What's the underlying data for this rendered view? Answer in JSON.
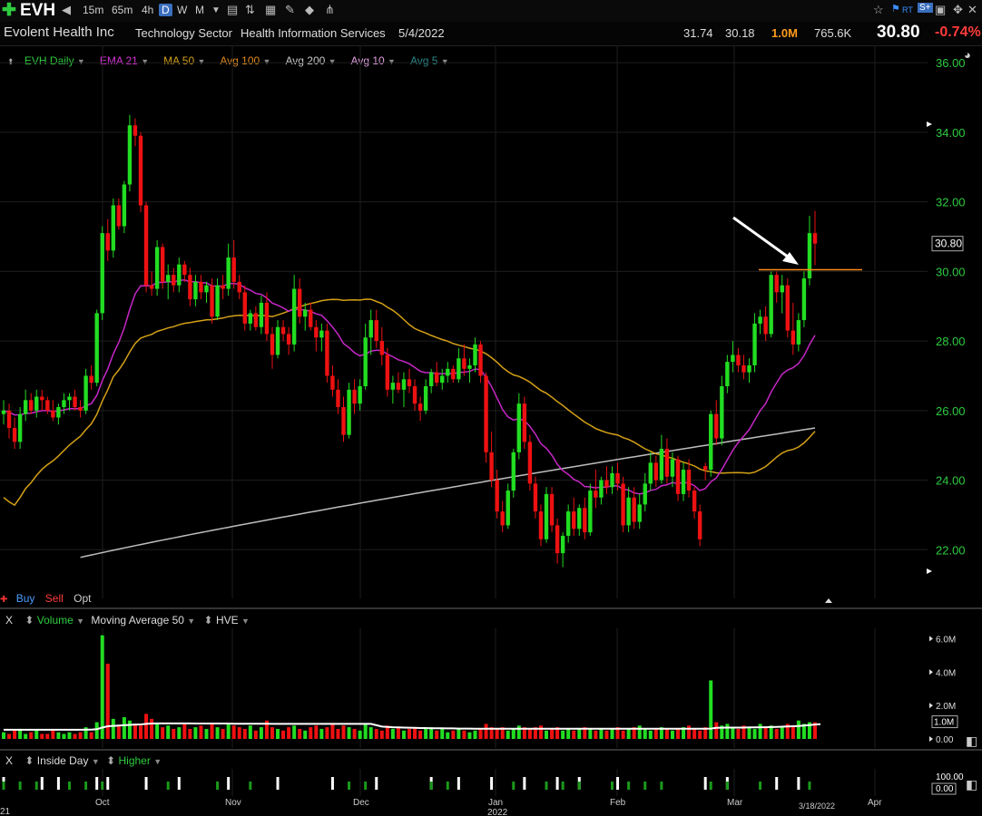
{
  "toolbar": {
    "symbol": "EVH",
    "timeframes": [
      "15m",
      "65m",
      "4h",
      "D",
      "W",
      "M"
    ],
    "active_timeframe": "D"
  },
  "info": {
    "company": "Evolent Health Inc",
    "sector": "Technology Sector",
    "industry": "Health Information Services",
    "date": "5/4/2022",
    "high": "31.74",
    "low": "30.18",
    "volume": "1.0M",
    "avg_volume": "765.6K",
    "price": "30.80",
    "change": "-0.74%"
  },
  "legend": {
    "items": [
      {
        "label": "EVH Daily",
        "color": "#2ecc40"
      },
      {
        "label": "EMA 21",
        "color": "#d633d6"
      },
      {
        "label": "MA 50",
        "color": "#d4a017"
      },
      {
        "label": "Avg 100",
        "color": "#e08a1e"
      },
      {
        "label": "Avg 200",
        "color": "#cccccc"
      },
      {
        "label": "Avg 10",
        "color": "#e0a0e0"
      },
      {
        "label": "Avg 5",
        "color": "#2a8a8a"
      }
    ]
  },
  "buysell": {
    "buy": "Buy",
    "sell": "Sell",
    "opt": "Opt"
  },
  "volume_panel": {
    "close": "X",
    "title": "Volume",
    "ma": "Moving Average 50",
    "hve": "HVE"
  },
  "inside_panel": {
    "close": "X",
    "title": "Inside Day",
    "second": "Higher"
  },
  "colors": {
    "up": "#22dd22",
    "down": "#ee1111",
    "bg": "#000000"
  },
  "chart_data": {
    "type": "candlestick",
    "price_axis": {
      "ticks": [
        "36.00",
        "34.00",
        "32.00",
        "30.00",
        "28.00",
        "26.00",
        "24.00",
        "22.00"
      ],
      "range": [
        20.6,
        36.5
      ]
    },
    "last_price_label": "30.80",
    "resistance_level": 30.05,
    "x_labels": [
      "Oct",
      "Nov",
      "Dec",
      "Jan",
      "Feb",
      "Mar",
      "Apr"
    ],
    "x_year_label": "2022",
    "x_left_partial": "21",
    "x_date_marker": "3/18/2022",
    "candles": [
      [
        25.9,
        26.3,
        25.6,
        26.0
      ],
      [
        26.0,
        26.2,
        25.2,
        25.5
      ],
      [
        25.5,
        25.8,
        24.9,
        25.1
      ],
      [
        25.1,
        26.1,
        24.9,
        25.9
      ],
      [
        25.9,
        26.6,
        25.7,
        26.3
      ],
      [
        26.3,
        26.5,
        25.9,
        26.0
      ],
      [
        26.0,
        26.6,
        25.8,
        26.4
      ],
      [
        26.4,
        26.6,
        26.0,
        26.3
      ],
      [
        26.3,
        26.4,
        25.9,
        26.0
      ],
      [
        26.0,
        26.3,
        25.7,
        25.8
      ],
      [
        25.8,
        26.2,
        25.6,
        26.1
      ],
      [
        26.1,
        26.5,
        25.9,
        26.3
      ],
      [
        26.3,
        26.5,
        26.0,
        26.4
      ],
      [
        26.4,
        26.6,
        26.0,
        26.1
      ],
      [
        26.1,
        26.3,
        25.8,
        26.0
      ],
      [
        26.0,
        27.2,
        25.9,
        27.0
      ],
      [
        27.0,
        27.3,
        26.6,
        26.8
      ],
      [
        26.8,
        28.9,
        26.7,
        28.8
      ],
      [
        28.8,
        31.3,
        28.6,
        31.1
      ],
      [
        31.1,
        31.5,
        30.3,
        30.6
      ],
      [
        30.6,
        32.1,
        30.4,
        31.9
      ],
      [
        31.9,
        32.1,
        31.2,
        31.3
      ],
      [
        31.3,
        32.6,
        31.1,
        32.5
      ],
      [
        32.5,
        34.5,
        32.3,
        34.2
      ],
      [
        34.2,
        34.4,
        33.6,
        33.9
      ],
      [
        33.9,
        34.0,
        31.7,
        31.9
      ],
      [
        31.9,
        32.0,
        29.4,
        29.6
      ],
      [
        29.6,
        30.0,
        29.3,
        29.5
      ],
      [
        29.5,
        30.9,
        29.3,
        30.7
      ],
      [
        30.7,
        30.8,
        29.5,
        29.7
      ],
      [
        29.7,
        30.2,
        29.2,
        29.9
      ],
      [
        29.9,
        30.1,
        29.4,
        29.6
      ],
      [
        29.6,
        30.4,
        29.4,
        30.2
      ],
      [
        30.2,
        30.3,
        29.7,
        29.9
      ],
      [
        29.9,
        30.1,
        29.0,
        29.2
      ],
      [
        29.2,
        29.9,
        29.0,
        29.7
      ],
      [
        29.7,
        29.9,
        29.2,
        29.4
      ],
      [
        29.4,
        29.7,
        29.1,
        29.6
      ],
      [
        29.6,
        29.8,
        28.5,
        28.7
      ],
      [
        28.7,
        29.8,
        28.6,
        29.6
      ],
      [
        29.6,
        29.9,
        29.2,
        29.5
      ],
      [
        29.5,
        30.8,
        29.3,
        30.4
      ],
      [
        30.4,
        30.9,
        29.5,
        29.7
      ],
      [
        29.7,
        29.9,
        29.2,
        29.4
      ],
      [
        29.4,
        29.6,
        28.3,
        28.5
      ],
      [
        28.5,
        28.9,
        28.3,
        28.8
      ],
      [
        28.8,
        29.0,
        28.3,
        28.4
      ],
      [
        28.4,
        29.3,
        28.2,
        29.1
      ],
      [
        29.1,
        29.4,
        28.0,
        28.2
      ],
      [
        28.2,
        28.4,
        27.2,
        27.6
      ],
      [
        27.6,
        28.6,
        27.5,
        28.4
      ],
      [
        28.4,
        28.6,
        28.0,
        28.2
      ],
      [
        28.2,
        28.4,
        27.6,
        27.9
      ],
      [
        27.9,
        29.9,
        27.7,
        29.5
      ],
      [
        29.5,
        29.8,
        28.5,
        28.7
      ],
      [
        28.7,
        29.1,
        28.3,
        28.9
      ],
      [
        28.9,
        29.1,
        28.3,
        28.4
      ],
      [
        28.4,
        28.6,
        27.7,
        28.1
      ],
      [
        28.1,
        28.5,
        27.7,
        28.3
      ],
      [
        28.3,
        28.5,
        26.8,
        27.0
      ],
      [
        27.0,
        27.3,
        26.4,
        26.6
      ],
      [
        26.6,
        26.9,
        25.9,
        26.1
      ],
      [
        26.1,
        26.4,
        25.1,
        25.3
      ],
      [
        25.3,
        26.8,
        25.2,
        26.6
      ],
      [
        26.6,
        26.9,
        25.9,
        26.2
      ],
      [
        26.2,
        26.9,
        26.0,
        26.7
      ],
      [
        26.7,
        28.5,
        26.6,
        28.1
      ],
      [
        28.1,
        28.9,
        27.6,
        28.6
      ],
      [
        28.6,
        28.9,
        27.8,
        28.0
      ],
      [
        28.0,
        28.4,
        27.3,
        27.6
      ],
      [
        27.6,
        27.8,
        26.4,
        26.6
      ],
      [
        26.6,
        27.0,
        26.2,
        26.8
      ],
      [
        26.8,
        27.1,
        26.5,
        26.6
      ],
      [
        26.6,
        27.1,
        26.1,
        26.9
      ],
      [
        26.9,
        27.2,
        26.5,
        26.7
      ],
      [
        26.7,
        26.9,
        26.0,
        26.2
      ],
      [
        26.2,
        26.4,
        25.7,
        26.0
      ],
      [
        26.0,
        26.9,
        25.9,
        26.7
      ],
      [
        26.7,
        27.2,
        26.5,
        27.1
      ],
      [
        27.1,
        27.4,
        26.7,
        26.8
      ],
      [
        26.8,
        27.2,
        26.6,
        27.0
      ],
      [
        27.0,
        27.4,
        26.8,
        27.2
      ],
      [
        27.2,
        27.3,
        26.8,
        26.9
      ],
      [
        26.9,
        27.8,
        26.8,
        27.5
      ],
      [
        27.5,
        27.9,
        27.0,
        27.2
      ],
      [
        27.2,
        27.5,
        26.8,
        27.3
      ],
      [
        27.3,
        28.1,
        27.1,
        27.9
      ],
      [
        27.9,
        28.0,
        26.8,
        27.0
      ],
      [
        27.0,
        27.1,
        24.5,
        24.8
      ],
      [
        24.8,
        25.4,
        23.8,
        24.0
      ],
      [
        24.0,
        24.3,
        22.9,
        23.1
      ],
      [
        23.1,
        23.4,
        22.5,
        22.7
      ],
      [
        22.7,
        23.9,
        22.6,
        23.7
      ],
      [
        23.7,
        24.9,
        23.5,
        24.8
      ],
      [
        24.8,
        26.5,
        24.6,
        26.2
      ],
      [
        26.2,
        26.4,
        24.9,
        25.1
      ],
      [
        25.1,
        25.3,
        23.7,
        23.9
      ],
      [
        23.9,
        24.1,
        22.9,
        23.1
      ],
      [
        23.1,
        23.3,
        22.1,
        22.3
      ],
      [
        22.3,
        23.8,
        22.2,
        23.6
      ],
      [
        23.6,
        23.8,
        22.5,
        22.7
      ],
      [
        22.7,
        22.9,
        21.6,
        21.9
      ],
      [
        21.9,
        22.5,
        21.5,
        22.4
      ],
      [
        22.4,
        23.3,
        22.2,
        23.1
      ],
      [
        23.1,
        23.5,
        22.4,
        22.6
      ],
      [
        22.6,
        23.3,
        22.4,
        23.2
      ],
      [
        23.2,
        23.5,
        22.3,
        22.5
      ],
      [
        22.5,
        23.9,
        22.4,
        23.7
      ],
      [
        23.7,
        24.3,
        23.2,
        23.5
      ],
      [
        23.5,
        24.1,
        23.3,
        24.0
      ],
      [
        24.0,
        24.4,
        23.6,
        23.8
      ],
      [
        23.8,
        24.4,
        23.6,
        24.2
      ],
      [
        24.2,
        24.5,
        23.7,
        23.9
      ],
      [
        23.9,
        24.1,
        22.5,
        22.7
      ],
      [
        22.7,
        23.8,
        22.5,
        23.5
      ],
      [
        23.5,
        23.8,
        22.6,
        22.8
      ],
      [
        22.8,
        23.6,
        22.6,
        23.3
      ],
      [
        23.3,
        24.2,
        23.1,
        23.9
      ],
      [
        23.9,
        24.8,
        23.7,
        24.5
      ],
      [
        24.5,
        24.7,
        23.8,
        24.0
      ],
      [
        24.0,
        25.3,
        23.9,
        24.9
      ],
      [
        24.9,
        25.2,
        23.9,
        24.1
      ],
      [
        24.1,
        24.8,
        23.8,
        24.6
      ],
      [
        24.6,
        24.7,
        23.4,
        23.6
      ],
      [
        23.6,
        24.5,
        23.4,
        24.3
      ],
      [
        24.3,
        24.6,
        23.5,
        23.7
      ],
      [
        23.7,
        23.8,
        22.9,
        23.1
      ],
      [
        23.1,
        23.3,
        22.1,
        22.3
      ],
      [
        24.4,
        24.5,
        24.0,
        24.3
      ],
      [
        24.3,
        26.0,
        24.1,
        25.9
      ],
      [
        25.9,
        26.3,
        25.0,
        25.2
      ],
      [
        25.2,
        27.0,
        25.0,
        26.7
      ],
      [
        26.7,
        27.6,
        26.5,
        27.4
      ],
      [
        27.4,
        28.0,
        27.1,
        27.6
      ],
      [
        27.6,
        27.8,
        27.1,
        27.3
      ],
      [
        27.3,
        27.6,
        26.9,
        27.1
      ],
      [
        27.1,
        27.5,
        26.8,
        27.3
      ],
      [
        27.3,
        28.8,
        27.1,
        28.5
      ],
      [
        28.5,
        28.9,
        28.2,
        28.7
      ],
      [
        28.7,
        29.0,
        28.0,
        28.2
      ],
      [
        28.2,
        30.0,
        28.1,
        29.9
      ],
      [
        29.9,
        30.0,
        29.1,
        29.4
      ],
      [
        29.4,
        29.9,
        28.8,
        29.6
      ],
      [
        29.6,
        29.8,
        28.1,
        28.3
      ],
      [
        28.3,
        29.1,
        27.6,
        27.9
      ],
      [
        27.9,
        28.8,
        27.7,
        28.6
      ],
      [
        28.6,
        30.0,
        28.4,
        29.8
      ],
      [
        29.8,
        31.6,
        29.6,
        31.1
      ],
      [
        31.1,
        31.74,
        30.18,
        30.8
      ]
    ],
    "volume": {
      "axis_ticks": [
        "6.0M",
        "4.0M",
        "2.0M",
        "0.00"
      ],
      "range": [
        0,
        6.4
      ],
      "last_label": "1.0M",
      "values": [
        0.4,
        0.3,
        0.5,
        0.6,
        0.3,
        0.4,
        0.5,
        0.3,
        0.3,
        0.5,
        0.4,
        0.3,
        0.4,
        0.3,
        0.4,
        0.7,
        0.4,
        1.0,
        6.2,
        4.5,
        1.2,
        0.8,
        1.3,
        1.1,
        0.9,
        0.8,
        1.5,
        1.2,
        0.9,
        0.7,
        0.8,
        0.6,
        0.7,
        0.9,
        0.6,
        0.7,
        0.8,
        0.6,
        0.9,
        0.7,
        0.6,
        0.9,
        0.8,
        0.7,
        0.6,
        0.8,
        0.5,
        0.7,
        1.1,
        0.7,
        0.6,
        0.5,
        0.7,
        0.8,
        0.6,
        0.5,
        0.7,
        0.8,
        0.6,
        0.7,
        0.9,
        0.6,
        0.8,
        0.7,
        0.6,
        0.5,
        0.9,
        0.7,
        0.6,
        0.5,
        0.8,
        0.6,
        0.7,
        0.5,
        0.6,
        0.7,
        0.5,
        0.6,
        0.7,
        0.5,
        0.6,
        0.4,
        0.5,
        0.6,
        0.5,
        0.4,
        0.5,
        0.6,
        0.9,
        0.7,
        0.6,
        0.7,
        0.5,
        0.6,
        0.8,
        0.7,
        0.6,
        0.7,
        0.8,
        0.5,
        0.6,
        0.7,
        0.5,
        0.6,
        0.5,
        0.6,
        0.7,
        0.6,
        0.5,
        0.6,
        0.5,
        0.6,
        0.7,
        0.5,
        0.6,
        0.7,
        0.8,
        0.6,
        0.5,
        0.6,
        0.7,
        0.6,
        0.5,
        0.6,
        0.7,
        0.8,
        0.6,
        0.5,
        0.7,
        3.5,
        1.0,
        0.8,
        0.9,
        0.7,
        0.6,
        0.8,
        0.7,
        0.6,
        0.9,
        0.7,
        0.8,
        0.6,
        0.7,
        0.9,
        0.8,
        1.1,
        0.9,
        1.0,
        1.0
      ],
      "ma50": [
        0.55,
        0.55,
        0.55,
        0.55,
        0.55,
        0.55,
        0.55,
        0.55,
        0.55,
        0.55,
        0.55,
        0.55,
        0.55,
        0.55,
        0.55,
        0.56,
        0.56,
        0.58,
        0.68,
        0.76,
        0.78,
        0.8,
        0.82,
        0.84,
        0.86,
        0.87,
        0.9,
        0.92,
        0.93,
        0.93,
        0.93,
        0.93,
        0.93,
        0.93,
        0.93,
        0.92,
        0.92,
        0.92,
        0.92,
        0.92,
        0.92,
        0.92,
        0.91,
        0.91,
        0.91,
        0.91,
        0.91,
        0.91,
        0.91,
        0.9,
        0.9,
        0.9,
        0.9,
        0.9,
        0.9,
        0.9,
        0.9,
        0.9,
        0.9,
        0.9,
        0.9,
        0.9,
        0.9,
        0.9,
        0.9,
        0.9,
        0.9,
        0.9,
        0.82,
        0.74,
        0.72,
        0.7,
        0.69,
        0.68,
        0.67,
        0.66,
        0.65,
        0.65,
        0.64,
        0.64,
        0.64,
        0.63,
        0.63,
        0.62,
        0.62,
        0.62,
        0.61,
        0.61,
        0.61,
        0.61,
        0.61,
        0.61,
        0.61,
        0.61,
        0.61,
        0.61,
        0.61,
        0.61,
        0.61,
        0.61,
        0.61,
        0.61,
        0.61,
        0.61,
        0.61,
        0.61,
        0.61,
        0.61,
        0.61,
        0.61,
        0.61,
        0.61,
        0.61,
        0.61,
        0.61,
        0.61,
        0.61,
        0.61,
        0.61,
        0.61,
        0.61,
        0.61,
        0.61,
        0.61,
        0.61,
        0.61,
        0.61,
        0.61,
        0.61,
        0.62,
        0.66,
        0.67,
        0.68,
        0.68,
        0.68,
        0.68,
        0.69,
        0.69,
        0.7,
        0.7,
        0.71,
        0.72,
        0.73,
        0.75,
        0.76,
        0.77,
        0.8,
        0.83,
        0.86,
        0.88
      ]
    },
    "inside_day": {
      "axis_ticks": [
        "100.00",
        "0.00"
      ],
      "white_marks": [
        0,
        7,
        10,
        17,
        19,
        26,
        32,
        41,
        50,
        60,
        68,
        78,
        83,
        89,
        95,
        101,
        105,
        112,
        128,
        132,
        141,
        145
      ]
    }
  }
}
